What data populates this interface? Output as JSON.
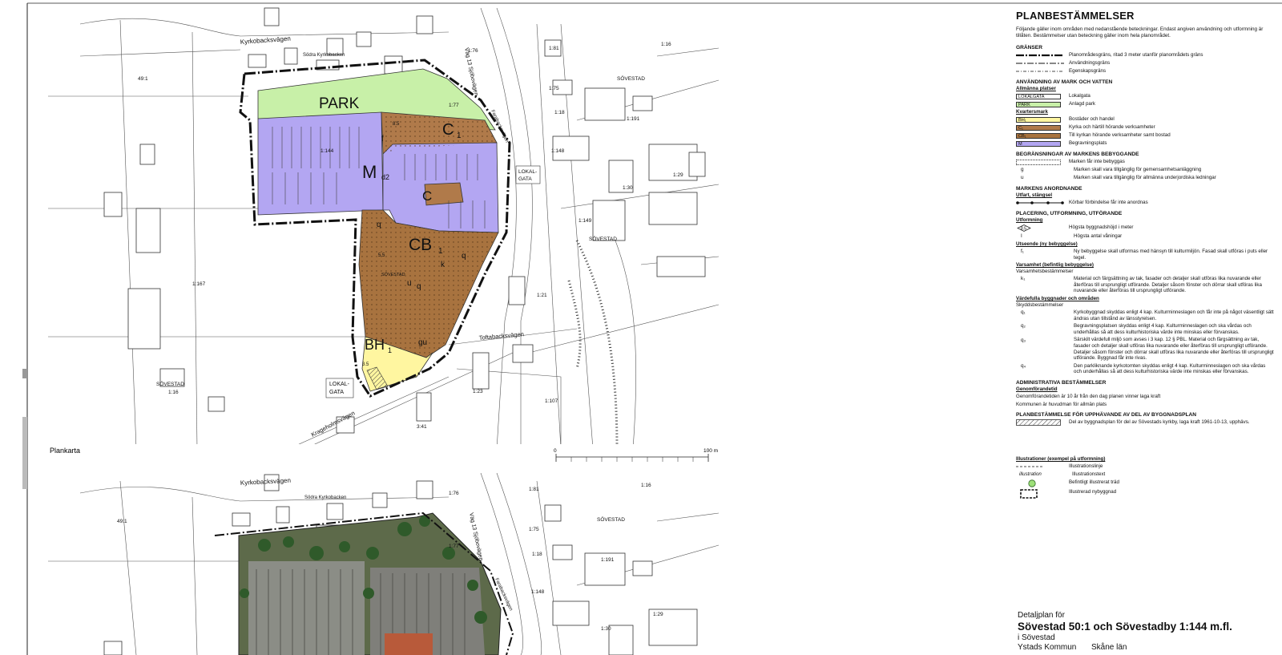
{
  "map": {
    "plan_label": "Plankarta",
    "scale_start": "0",
    "scale_end": "100 m",
    "zones": {
      "park": "PARK",
      "c1": "C",
      "c1_sub": "1",
      "c1_small": "C",
      "m": "M",
      "m_sub": "d2",
      "cb": "CB",
      "cb_sub": "1",
      "bh": "BH",
      "bh_sub": "1"
    },
    "streets": {
      "kyrkobacksvagen": "Kyrkobacksvägen",
      "sodra_kyrkobacken": "Södra Kyrkobacken",
      "vag13": "Väg 13 Sjöbovägen",
      "faraback": "Farabacksvägen",
      "toftabacksvagen": "Toftabacksvägen",
      "krageholmsvagen": "Krageholmsvägen",
      "lokalgata1": "LOKAL-",
      "lokalgata2": "GATA"
    },
    "places": {
      "sovestad_ne": "SÖVESTAD",
      "sovestad_e": "SÖVESTAD",
      "sovestad_w": "SÖVESTAD",
      "sovestad_mid": "SÖVESTAD"
    },
    "parcels": {
      "p491": "49:1",
      "p167": "1:167",
      "p177": "1:77",
      "p176": "1:76",
      "p116": "1:16",
      "p118": "1:18",
      "p119": "1:191",
      "p129": "1:29",
      "p130": "1:30",
      "p148": "1:148",
      "p149": "1:149",
      "p121": "1:21",
      "p107": "1:107",
      "p123": "1:23",
      "p144": "1:144",
      "p181": "1:81",
      "p175": "1:75",
      "p116b": "1:16",
      "p341": "3:41"
    },
    "symbols": {
      "q1": "q",
      "q4": "q",
      "f1": "f",
      "k1": "k",
      "q3": "q",
      "u": "u",
      "gu": "gu",
      "h1": "5.5",
      "h2": "8.5",
      "h3": "3.5"
    }
  },
  "legend": {
    "title": "PLANBESTÄMMELSER",
    "intro": "Följande gäller inom områden med nedanstående beteckningar. Endast angiven användning och utformning är tillåten. Bestämmelser utan beteckning gäller inom hela planområdet.",
    "granser": {
      "head": "GRÄNSER",
      "rows": [
        "Planområdesgräns, ritad 3 meter utanför planområdets gräns",
        "Användningsgräns",
        "Egenskapsgräns"
      ]
    },
    "anvandning": {
      "head": "ANVÄNDNING AV MARK OCH VATTEN",
      "sub_allmanna": "Allmänna platser",
      "allmanna": [
        {
          "code": "LOKALGATA",
          "text": "Lokalgata",
          "color": "#ffffff"
        },
        {
          "code": "PARK",
          "text": "Anlagd park",
          "color": "#c8f0a8"
        }
      ],
      "sub_kvarter": "Kvartersmark",
      "kvarter": [
        {
          "code": "BH₁",
          "text": "Bostäder och handel",
          "color": "#fff6a0"
        },
        {
          "code": "C₁",
          "text": "Kyrka och härtill hörande verksamheter",
          "color": "#b07a4a"
        },
        {
          "code": "CB₁",
          "text": "Till kyrkan hörande verksamheter samt bostad",
          "color": "#a8733f"
        },
        {
          "code": "M",
          "text": "Begravningsplats",
          "color": "#b3a6f2"
        }
      ]
    },
    "begransningar": {
      "head": "BEGRÄNSNINGAR AV MARKENS BEBYGGANDE",
      "rows": [
        {
          "code": "",
          "text": "Marken får inte bebyggas"
        },
        {
          "code": "g",
          "text": "Marken skall vara tillgänglig för gemensamhetsanläggning"
        },
        {
          "code": "u",
          "text": "Marken skall vara tillgänglig för allmänna underjordiska ledningar"
        }
      ]
    },
    "anordnande": {
      "head": "MARKENS ANORDNANDE",
      "sub": "Utfart, stängsel",
      "row": "Körbar förbindelse får inte anordnas"
    },
    "placering": {
      "head": "PLACERING, UTFORMNING, UTFÖRANDE",
      "sub": "Utformning",
      "rows": [
        {
          "code": "8.5",
          "text": "Högsta byggnadshöjd i meter"
        },
        {
          "code": "I",
          "text": "Högsta antal våningar"
        }
      ]
    },
    "utseende": {
      "sub": "Utseende (ny bebyggelse)",
      "code": "f₁",
      "text": "Ny bebyggelse skall utformas med hänsyn till kulturmiljön. Fasad skall utföras i puts eller tegel."
    },
    "varsamhet": {
      "sub": "Varsamhet (befintlig bebyggelse)",
      "plain": "Varsamhetsbestämmelser",
      "code": "k₁",
      "text": "Material och färgsättning av tak, fasader och detaljer skall utföras lika nuvarande eller återföras till ursprungligt utförande. Detaljer såsom fönster och dörrar skall utföras lika nuvarande eller återföras till ursprungligt utförande."
    },
    "vardefulla": {
      "sub": "Värdefulla byggnader och områden",
      "plain": "Skyddsbestämmelser",
      "rows": [
        {
          "code": "q₁",
          "text": "Kyrkobyggnad skyddas enligt 4 kap. Kulturminneslagen och får inte på något väsentligt sätt ändras utan tillstånd av länsstyrelsen."
        },
        {
          "code": "q₂",
          "text": "Begravningsplatsen skyddas enligt 4 kap. Kulturminneslagen och ska vårdas och underhållas så att dess kulturhistoriska värde inte minskas eller förvanskas."
        },
        {
          "code": "q₃",
          "text": "Särskilt värdefull miljö som avses i 3 kap. 12 § PBL. Material och färgsättning av tak, fasader och detaljer skall utföras lika nuvarande eller återföras till ursprungligt utförande. Detaljer såsom fönster och dörrar skall utföras lika nuvarande eller återföras till ursprungligt utförande. Byggnad får inte rivas."
        },
        {
          "code": "q₄",
          "text": "Den parkliknande kyrkotomten skyddas enligt 4 kap. Kulturminneslagen och ska vårdas och underhållas så att dess kulturhistoriska värde inte minskas eller förvanskas."
        }
      ]
    },
    "administrativa": {
      "head": "ADMINISTRATIVA BESTÄMMELSER",
      "sub": "Genomförandetid",
      "rows": [
        "Genomförandetiden är 10 år från den dag planen vinner laga kraft",
        "Kommunen är huvudman för allmän plats"
      ]
    },
    "upphavande": {
      "head": "PLANBESTÄMMELSE FÖR UPPHÄVANDE AV DEL AV BYGGNADSPLAN",
      "text": "Del av byggnadsplan för del av Sövestads kyrkby, laga kraft 1961-10-13, upphävs."
    },
    "illustrationer": {
      "head": "Illustrationer (exempel på utformning)",
      "rows": [
        {
          "code": "",
          "text": "Illustrationslinje"
        },
        {
          "code": "illustration",
          "text": "Illustrationstext"
        },
        {
          "code": "",
          "text": "Befintligt illustrerat träd"
        },
        {
          "code": "",
          "text": "Illustrerad nybyggnad"
        }
      ]
    }
  },
  "title_block": {
    "line1": "Detaljplan för",
    "line2": "Sövestad 50:1 och Sövestadby 1:144 m.fl.",
    "line3": "i Sövestad",
    "municipality": "Ystads Kommun",
    "county": "Skåne län"
  },
  "colors": {
    "park": "#c8f0a8",
    "church": "#b07a4a",
    "cb": "#a8733f",
    "cemetery": "#b3a6f2",
    "bh": "#fff6a0"
  }
}
